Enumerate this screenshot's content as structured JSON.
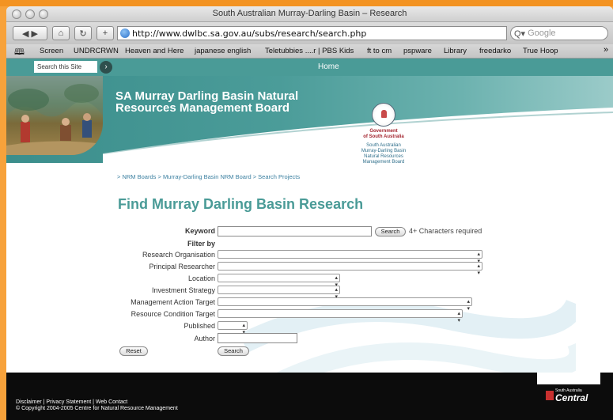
{
  "window": {
    "title": "South Australian Murray-Darling Basin – Research"
  },
  "toolbar": {
    "back_forward": "◀ ▶",
    "home_glyph": "⌂",
    "reload_glyph": "↻",
    "add_glyph": "+",
    "url": "http://www.dwlbc.sa.gov.au/subs/research/search.php",
    "search_placeholder": "Google"
  },
  "bookmarks": {
    "book_icon": "🕮",
    "items": [
      "Screen",
      "UNDRCRWN",
      "Heaven and Here",
      "japanese english",
      "Teletubbies ....r | PBS Kids",
      "ft to cm",
      "pspware",
      "Library",
      "freedarko",
      "True Hoop"
    ],
    "overflow": "»"
  },
  "site": {
    "search_label": "Search this Site",
    "go_glyph": "›",
    "home": "Home",
    "board_title_line1": "SA Murray Darling Basin Natural",
    "board_title_line2": "Resources Management Board",
    "logo": {
      "gov_line1": "Government",
      "gov_line2": "of South Australia",
      "sub_line1": "South Australian",
      "sub_line2": "Murray-Darling Basin",
      "sub_line3": "Natural Resources",
      "sub_line4": "Management Board"
    },
    "breadcrumb": "> NRM Boards > Murray-Darling Basin NRM Board > Search Projects"
  },
  "form": {
    "title": "Find Murray Darling Basin Research",
    "keyword_label": "Keyword",
    "keyword_value": "",
    "search_button": "Search",
    "hint": "4+ Characters required",
    "filter_by": "Filter by",
    "research_org_label": "Research Organisation",
    "principal_researcher_label": "Principal Researcher",
    "location_label": "Location",
    "investment_strategy_label": "Investment Strategy",
    "management_action_label": "Management Action Target",
    "resource_condition_label": "Resource Condition Target",
    "published_label": "Published",
    "author_label": "Author",
    "author_value": "",
    "reset_button": "Reset",
    "search_button_bottom": "Search"
  },
  "footer": {
    "links": "Disclaimer | Privacy Statement | Web Contact",
    "copyright": "© Copyright 2004-2005 Centre for Natural Resource Management",
    "central_small": "South Australia",
    "central_big": "Central"
  }
}
